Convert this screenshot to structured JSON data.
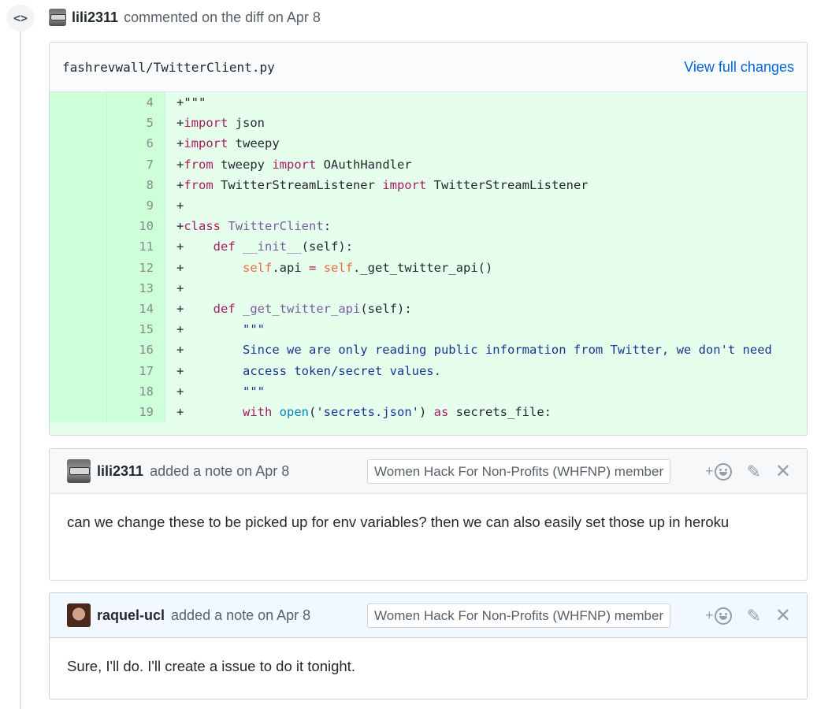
{
  "header": {
    "author": "lili2311",
    "action_text": "commented on the diff on Apr 8",
    "code_icon_glyph": "<>"
  },
  "diff": {
    "file_path": "fashrevwall/TwitterClient.py",
    "view_changes_label": "View full changes",
    "line_numbers": [
      "4",
      "5",
      "6",
      "7",
      "8",
      "9",
      "10",
      "11",
      "12",
      "13",
      "14",
      "15",
      "16",
      "17",
      "18",
      "19"
    ]
  },
  "notes": [
    {
      "author": "lili2311",
      "action_text": "added a note on Apr 8",
      "badge": "Women Hack For Non-Profits (WHFNP) member",
      "react_plus": "+",
      "body": "can we change these to be picked up for env variables? then we can also easily set those up in heroku"
    },
    {
      "author": "raquel-ucl",
      "action_text": "added a note on Apr 8",
      "badge": "Women Hack For Non-Profits (WHFNP) member",
      "react_plus": "+",
      "body": "Sure, I'll do. I'll create a issue to do it tonight."
    }
  ],
  "icons": {
    "pencil": "✎",
    "close": "✕"
  },
  "colors": {
    "link": "#0366d6",
    "addition_bg": "#e6ffed",
    "addition_num_bg": "#cdffd8"
  }
}
